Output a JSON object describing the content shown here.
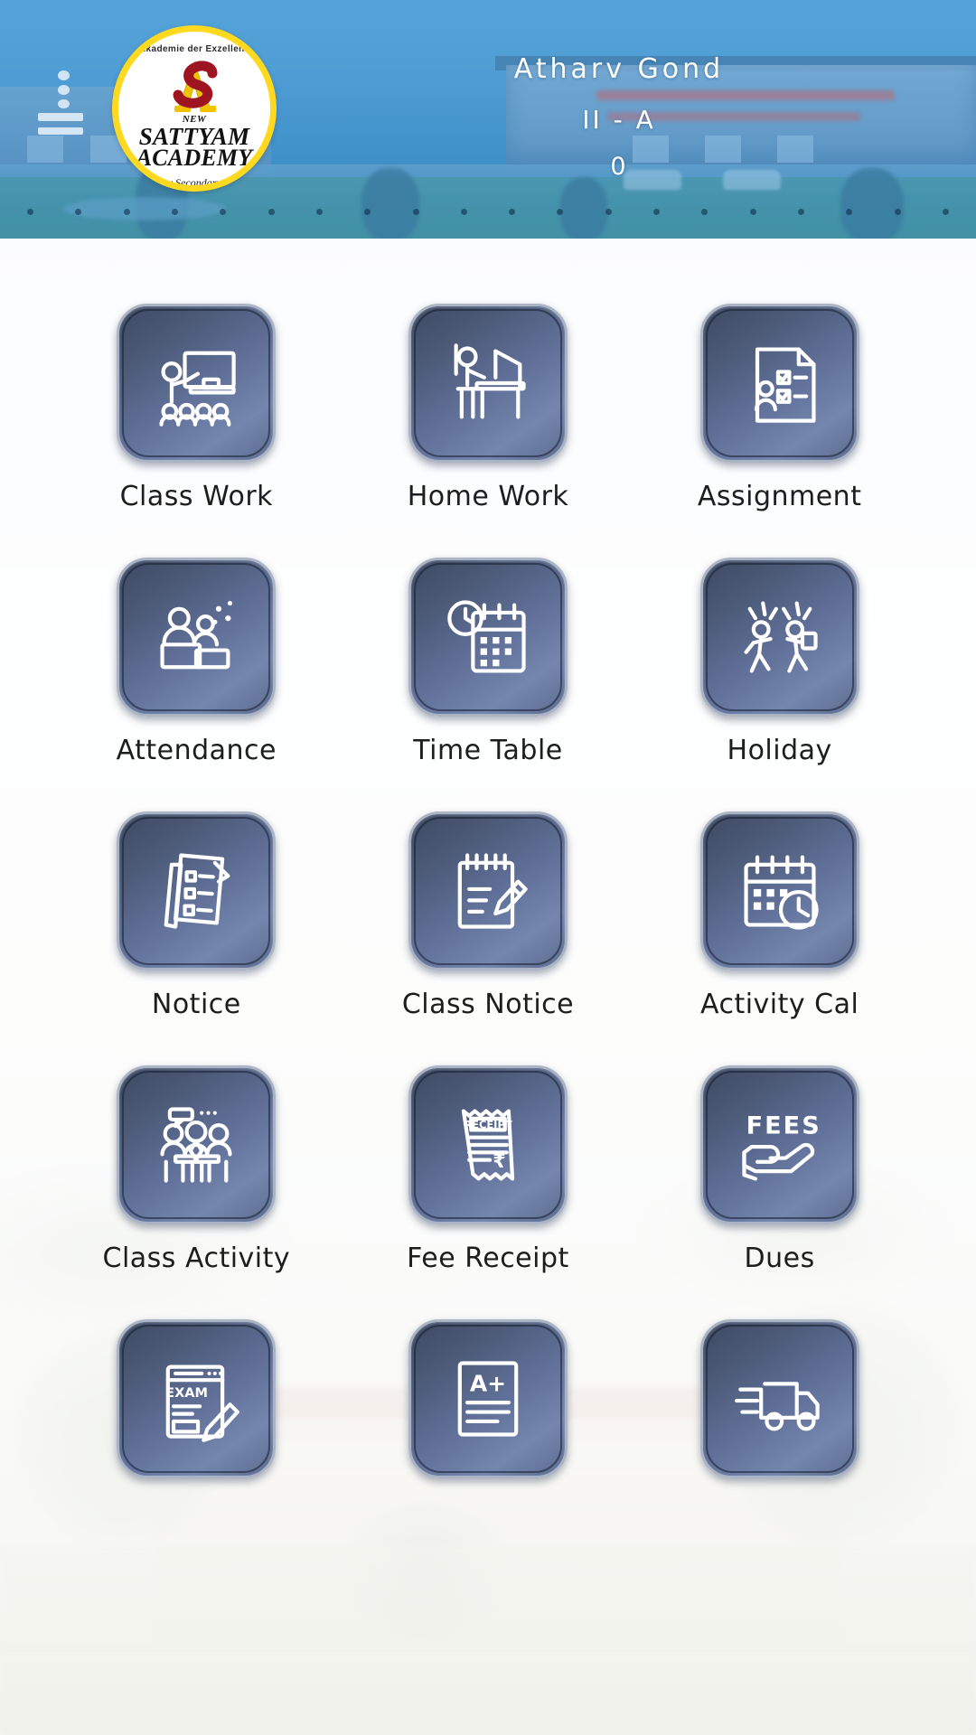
{
  "header": {
    "menu_icon": "hamburger-menu-icon",
    "logo": {
      "arc_text": "Akademie der Exzellenz",
      "new": "NEW",
      "line1": "SATTYAM",
      "line2": "ACADEMY",
      "tagline": "A Senior Secondary School"
    },
    "student": {
      "name": "Atharv Gond",
      "class": "II - A",
      "extra": "0"
    },
    "colors": {
      "header_blue": "#4f9bd0",
      "logo_ring_yellow": "#ffd91f",
      "text_white": "#ffffff"
    }
  },
  "grid": {
    "tile_colors": {
      "gradient_start": "#3d4a63",
      "gradient_mid": "#61719a",
      "gradient_end": "#5d6c8f",
      "border": "#aab4c4",
      "icon_stroke": "#ffffff"
    },
    "items": [
      {
        "label": "Class Work",
        "icon": "teacher-blackboard-icon"
      },
      {
        "label": "Home Work",
        "icon": "student-desk-icon"
      },
      {
        "label": "Assignment",
        "icon": "document-checklist-icon"
      },
      {
        "label": "Attendance",
        "icon": "attendance-people-icon"
      },
      {
        "label": "Time Table",
        "icon": "calendar-clock-icon"
      },
      {
        "label": "Holiday",
        "icon": "children-running-icon"
      },
      {
        "label": "Notice",
        "icon": "notice-papers-icon"
      },
      {
        "label": "Class Notice",
        "icon": "notepad-pencil-icon"
      },
      {
        "label": "Activity Cal",
        "icon": "calendar-clock-activity-icon"
      },
      {
        "label": "Class Activity",
        "icon": "group-discussion-icon"
      },
      {
        "label": "Fee Receipt",
        "icon": "receipt-rupee-icon"
      },
      {
        "label": "Dues",
        "icon": "fees-hand-icon"
      },
      {
        "label": "",
        "icon": "exam-paper-pencil-icon"
      },
      {
        "label": "",
        "icon": "grade-aplus-icon"
      },
      {
        "label": "",
        "icon": "transport-truck-icon"
      }
    ],
    "icon_texts": {
      "receipt": "RECEIPT",
      "rupee": "₹",
      "fees": "FEES",
      "exam": "EXAM",
      "grade": "A+"
    }
  }
}
